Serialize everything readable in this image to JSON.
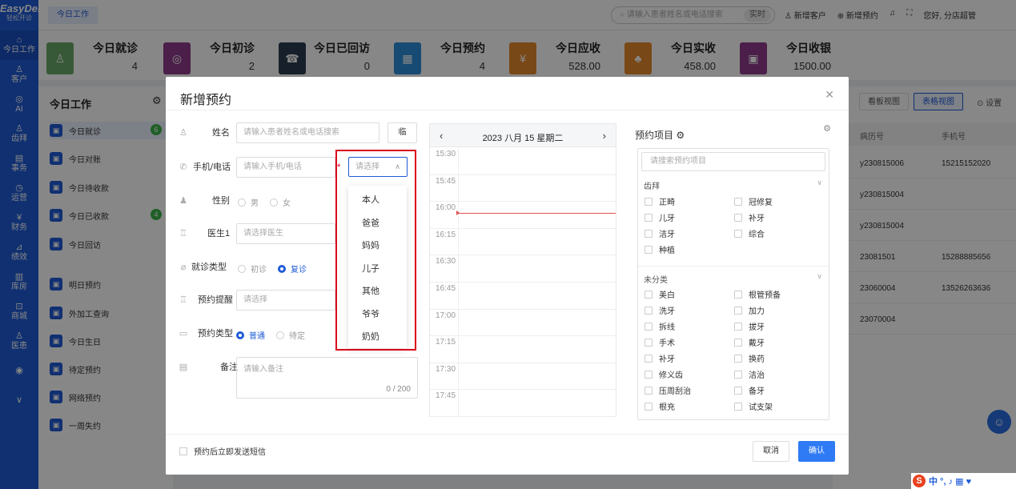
{
  "app": {
    "logo": "EasyDent",
    "logo_sub": "轻松开诊",
    "top_tab": "今日工作",
    "search_placeholder": "请输入患者姓名或电话搜索",
    "search_btn": "实时",
    "new_customer": "新增客户",
    "new_appt": "新增预约",
    "greeting": "您好, 分店超管"
  },
  "nav": [
    {
      "icon": "⌂",
      "label": "今日工作"
    },
    {
      "icon": "♙",
      "label": "客户"
    },
    {
      "icon": "◎",
      "label": "AI"
    },
    {
      "icon": "♙",
      "label": "齿拜"
    },
    {
      "icon": "▤",
      "label": "事务"
    },
    {
      "icon": "◷",
      "label": "运营"
    },
    {
      "icon": "¥",
      "label": "财务"
    },
    {
      "icon": "⊿",
      "label": "绩效"
    },
    {
      "icon": "▥",
      "label": "库房"
    },
    {
      "icon": "⊡",
      "label": "商城"
    },
    {
      "icon": "♙",
      "label": "医患"
    },
    {
      "icon": "◉",
      "label": ""
    },
    {
      "icon": "∨",
      "label": ""
    }
  ],
  "stats": [
    {
      "label": "今日就诊",
      "value": "4",
      "color": "#6aa86b",
      "icon": "♙"
    },
    {
      "label": "今日初诊",
      "value": "2",
      "color": "#8e3b8a",
      "icon": "◎"
    },
    {
      "label": "今日已回访",
      "value": "0",
      "color": "#2c3e50",
      "icon": "☎"
    },
    {
      "label": "今日预约",
      "value": "4",
      "color": "#2f8fd9",
      "icon": "▦"
    },
    {
      "label": "今日应收",
      "value": "528.00",
      "color": "#e5892c",
      "icon": "¥"
    },
    {
      "label": "今日实收",
      "value": "458.00",
      "color": "#e5892c",
      "icon": "♣"
    },
    {
      "label": "今日收银",
      "value": "1500.00",
      "color": "#8e3b8a",
      "icon": "▣"
    }
  ],
  "left": {
    "title": "今日工作",
    "items": [
      {
        "label": "今日就诊",
        "badge": "6"
      },
      {
        "label": "今日对账",
        "badge": ""
      },
      {
        "label": "今日待收款",
        "badge": ""
      },
      {
        "label": "今日已收款",
        "badge": "4"
      },
      {
        "label": "今日回访",
        "badge": ""
      },
      {
        "label": "明日预约",
        "badge": ""
      },
      {
        "label": "外加工查询",
        "badge": ""
      },
      {
        "label": "今日生日",
        "badge": ""
      },
      {
        "label": "待定预约",
        "badge": ""
      },
      {
        "label": "网络预约",
        "badge": ""
      },
      {
        "label": "一周失约",
        "badge": ""
      }
    ]
  },
  "right": {
    "btn_board": "看板视图",
    "btn_table": "表格视图",
    "btn_settings": "设置",
    "col_record": "病历号",
    "col_phone": "手机号",
    "rows": [
      {
        "record": "y230815006",
        "phone": "15215152020"
      },
      {
        "record": "y230815004",
        "phone": ""
      },
      {
        "record": "y230815004",
        "phone": ""
      },
      {
        "record": "23081501",
        "phone": "15288885656"
      },
      {
        "record": "23060004",
        "phone": "13526263636"
      },
      {
        "record": "23070004",
        "phone": ""
      }
    ]
  },
  "modal": {
    "title": "新增预约",
    "name_label": "姓名",
    "name_placeholder": "请输入患者姓名或电话搜索",
    "name_btn": "临",
    "phone_label": "手机/电话",
    "phone_placeholder": "请输入手机/电话",
    "relation_placeholder": "请选择",
    "relation_options": [
      "本人",
      "爸爸",
      "妈妈",
      "儿子",
      "其他",
      "爷爷",
      "奶奶"
    ],
    "gender_label": "性别",
    "gender_male": "男",
    "gender_female": "女",
    "doctor_label": "医生1",
    "doctor_placeholder": "请选择医生",
    "visit_type_label": "就诊类型",
    "visit_first": "初诊",
    "visit_return": "复诊",
    "reminder_label": "预约提醒",
    "reminder_placeholder": "请选择",
    "appt_type_label": "预约类型",
    "appt_normal": "普通",
    "appt_pending": "待定",
    "remark_label": "备注",
    "remark_placeholder": "请输入备注",
    "remark_count": "0 / 200",
    "sms_label": "预约后立即发送短信",
    "cancel": "取消",
    "confirm": "确认"
  },
  "calendar": {
    "date": "2023 八月 15 星期二",
    "slots": [
      "15:30",
      "15:45",
      "16:00",
      "16:15",
      "16:30",
      "16:45",
      "17:00",
      "17:15",
      "17:30",
      "17:45"
    ]
  },
  "projects": {
    "title": "预约项目",
    "search_placeholder": "请搜索预约项目",
    "group1": "齿拜",
    "group1_items": [
      "正畸",
      "冠修复",
      "儿牙",
      "补牙",
      "洁牙",
      "综合",
      "种植"
    ],
    "group2": "未分类",
    "group2_items": [
      "美白",
      "根管预备",
      "洗牙",
      "加力",
      "拆线",
      "拔牙",
      "手术",
      "戴牙",
      "补牙",
      "换药",
      "修义齿",
      "洁治",
      "压周刮治",
      "备牙",
      "根充",
      "试支架"
    ]
  },
  "ime": {
    "text": "中 °, ♪ ▦ ♥"
  }
}
